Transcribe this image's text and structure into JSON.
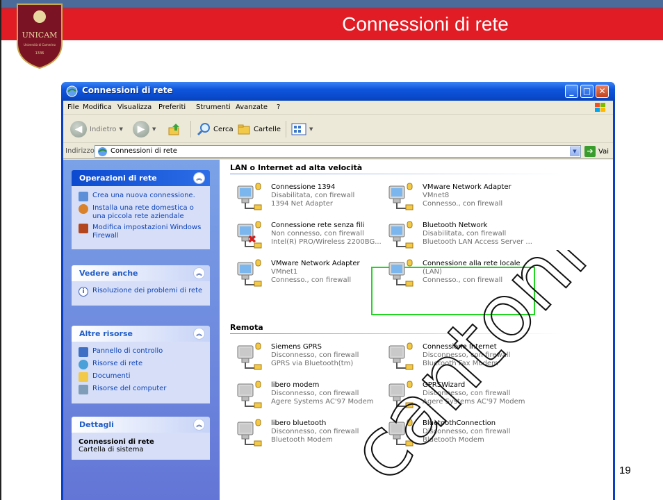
{
  "slide": {
    "title": "Connessioni di rete",
    "page_number": "19",
    "watermark": "cantoni",
    "logo": {
      "text": "UNICAM",
      "subtext": "Università di Camerino",
      "year": "1336"
    },
    "colors": {
      "red_band": "#e11c24",
      "top_band": "#4b6b9a",
      "highlight": "#21d621"
    }
  },
  "window": {
    "title": "Connessioni di rete",
    "menu": [
      {
        "label": "File"
      },
      {
        "label": "Modifica"
      },
      {
        "label": "Visualizza"
      },
      {
        "label": "Preferiti"
      },
      {
        "label": "Strumenti"
      },
      {
        "label": "Avanzate"
      },
      {
        "label": "?"
      }
    ],
    "toolbar": {
      "back": "Indietro",
      "search": "Cerca",
      "folders": "Cartelle"
    },
    "address": {
      "label": "Indirizzo",
      "value": "Connessioni di rete",
      "go": "Vai"
    },
    "left_pane": {
      "operations": {
        "title": "Operazioni di rete",
        "items": [
          {
            "label": "Crea una nuova connessione.",
            "icon": "new-connection-icon"
          },
          {
            "label": "Installa una rete domestica o una piccola rete aziendale",
            "icon": "home-network-icon"
          },
          {
            "label": "Modifica impostazioni Windows Firewall",
            "icon": "firewall-icon"
          }
        ]
      },
      "see_also": {
        "title": "Vedere anche",
        "items": [
          {
            "label": "Risoluzione dei problemi di rete",
            "icon": "info-icon"
          }
        ]
      },
      "other": {
        "title": "Altre risorse",
        "items": [
          {
            "label": "Pannello di controllo",
            "icon": "control-panel-icon"
          },
          {
            "label": "Risorse di rete",
            "icon": "network-places-icon"
          },
          {
            "label": "Documenti",
            "icon": "documents-icon"
          },
          {
            "label": "Risorse del computer",
            "icon": "my-computer-icon"
          }
        ]
      },
      "details": {
        "title": "Dettagli",
        "name": "Connessioni di rete",
        "type": "Cartella di sistema"
      }
    },
    "groups": {
      "lan": {
        "title": "LAN o Internet ad alta velocità",
        "items": [
          {
            "name": "Connessione 1394",
            "status": "Disabilitata, con firewall",
            "device": "1394 Net Adapter"
          },
          {
            "name": "VMware Network Adapter",
            "status": "VMnet8",
            "device": "Connesso., con firewall"
          },
          {
            "name": "Connessione rete senza fili",
            "status": "Non connesso, con firewall",
            "device": "Intel(R) PRO/Wireless 2200BG..."
          },
          {
            "name": "Bluetooth Network",
            "status": "Disabilitata, con firewall",
            "device": "Bluetooth LAN Access Server ..."
          },
          {
            "name": "VMware Network Adapter",
            "status": "VMnet1",
            "device": "Connesso., con firewall"
          },
          {
            "name": "Connessione alla rete locale",
            "status": "(LAN)",
            "device": "Connesso., con firewall"
          }
        ]
      },
      "remote": {
        "title": "Remota",
        "items": [
          {
            "name": "Siemens GPRS",
            "status": "Disconnesso, con firewall",
            "device": "GPRS via Bluetooth(tm)"
          },
          {
            "name": "Connessione Internet",
            "status": "Disconnesso, con firewall",
            "device": "Bluetooth Fax Modem"
          },
          {
            "name": "libero modem",
            "status": "Disconnesso, con firewall",
            "device": "Agere Systems AC'97 Modem"
          },
          {
            "name": "GPRSWizard",
            "status": "Disconnesso, con firewall",
            "device": "Agere Systems AC'97 Modem"
          },
          {
            "name": "libero bluetooth",
            "status": "Disconnesso, con firewall",
            "device": "Bluetooth Modem"
          },
          {
            "name": "BluetoothConnection",
            "status": "Disconnesso, con firewall",
            "device": "Bluetooth Modem"
          }
        ]
      }
    }
  }
}
